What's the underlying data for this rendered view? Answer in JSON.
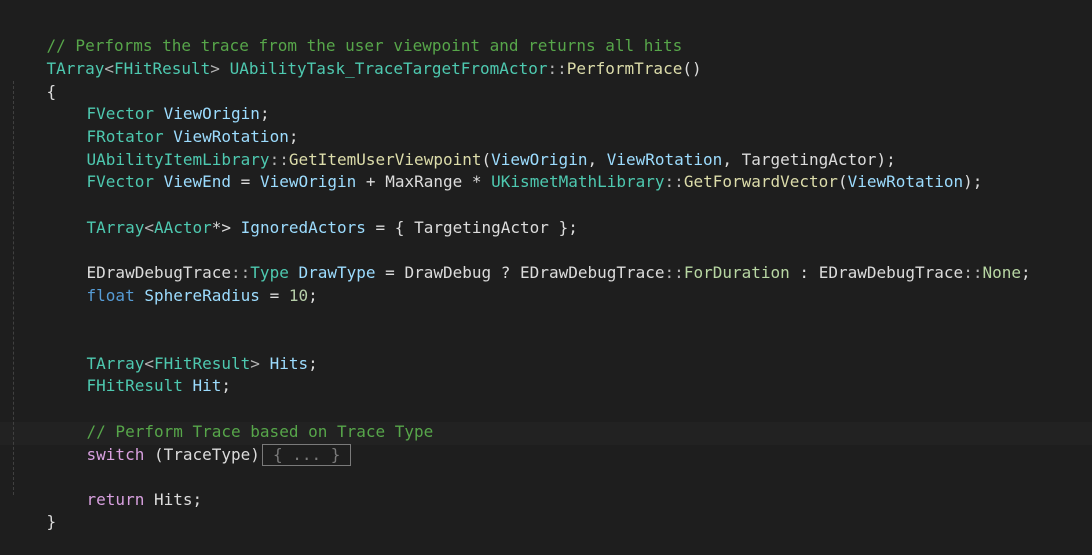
{
  "editor": {
    "colors": {
      "background": "#1e1e1e",
      "comment": "#57a64a",
      "type": "#4ec9b0",
      "variable": "#9cdcfe",
      "function": "#dcdcaa",
      "keyword": "#569cd6",
      "control": "#d8a0df",
      "number": "#b5cea8"
    },
    "lines": {
      "l1_comment": "// Performs the trace from the user viewpoint and returns all hits",
      "l2_rettype": "TArray",
      "l2_lt": "<",
      "l2_tparam": "FHitResult",
      "l2_gt": ">",
      "l2_class": "UAbilityTask_TraceTargetFromActor",
      "l2_scope": "::",
      "l2_func": "PerformTrace",
      "l2_parens": "()",
      "l3_open": "{",
      "l4_type": "FVector",
      "l4_var": "ViewOrigin",
      "l4_end": ";",
      "l5_type": "FRotator",
      "l5_var": "ViewRotation",
      "l5_end": ";",
      "l6_class": "UAbilityItemLibrary",
      "l6_scope": "::",
      "l6_func": "GetItemUserViewpoint",
      "l6_open": "(",
      "l6_arg1": "ViewOrigin",
      "l6_comma1": ", ",
      "l6_arg2": "ViewRotation",
      "l6_comma2": ", ",
      "l6_arg3": "TargetingActor",
      "l6_close": ");",
      "l7_type": "FVector",
      "l7_var": "ViewEnd",
      "l7_eq": " = ",
      "l7_a": "ViewOrigin",
      "l7_plus": " + ",
      "l7_b": "MaxRange",
      "l7_mul": " * ",
      "l7_class": "UKismetMathLibrary",
      "l7_scope": "::",
      "l7_func": "GetForwardVector",
      "l7_open": "(",
      "l7_arg": "ViewRotation",
      "l7_close": ");",
      "l9_type": "TArray",
      "l9_lt": "<",
      "l9_tparam": "AActor",
      "l9_ptr": "*>",
      "l9_var": "IgnoredActors",
      "l9_eq": " = { ",
      "l9_val": "TargetingActor",
      "l9_close": " };",
      "l11_enum": "EDrawDebugTrace",
      "l11_scope": "::",
      "l11_type": "Type",
      "l11_var": "DrawType",
      "l11_eq": " = ",
      "l11_cond": "DrawDebug",
      "l11_q": " ? ",
      "l11_enum2": "EDrawDebugTrace",
      "l11_scope2": "::",
      "l11_val1": "ForDuration",
      "l11_colon": " : ",
      "l11_enum3": "EDrawDebugTrace",
      "l11_scope3": "::",
      "l11_val2": "None",
      "l11_end": ";",
      "l12_kw": "float",
      "l12_var": "SphereRadius",
      "l12_eq": " = ",
      "l12_num": "10",
      "l12_end": ";",
      "l15_type": "TArray",
      "l15_lt": "<",
      "l15_tparam": "FHitResult",
      "l15_gt": ">",
      "l15_var": "Hits",
      "l15_end": ";",
      "l16_type": "FHitResult",
      "l16_var": "Hit",
      "l16_end": ";",
      "l18_comment": "// Perform Trace based on Trace Type",
      "l19_kw": "switch",
      "l19_open": " (",
      "l19_var": "TraceType",
      "l19_close": ")",
      "l19_collapsed": "{ ... }",
      "l21_kw": "return",
      "l21_var": "Hits",
      "l21_end": ";",
      "l22_close": "}"
    }
  }
}
